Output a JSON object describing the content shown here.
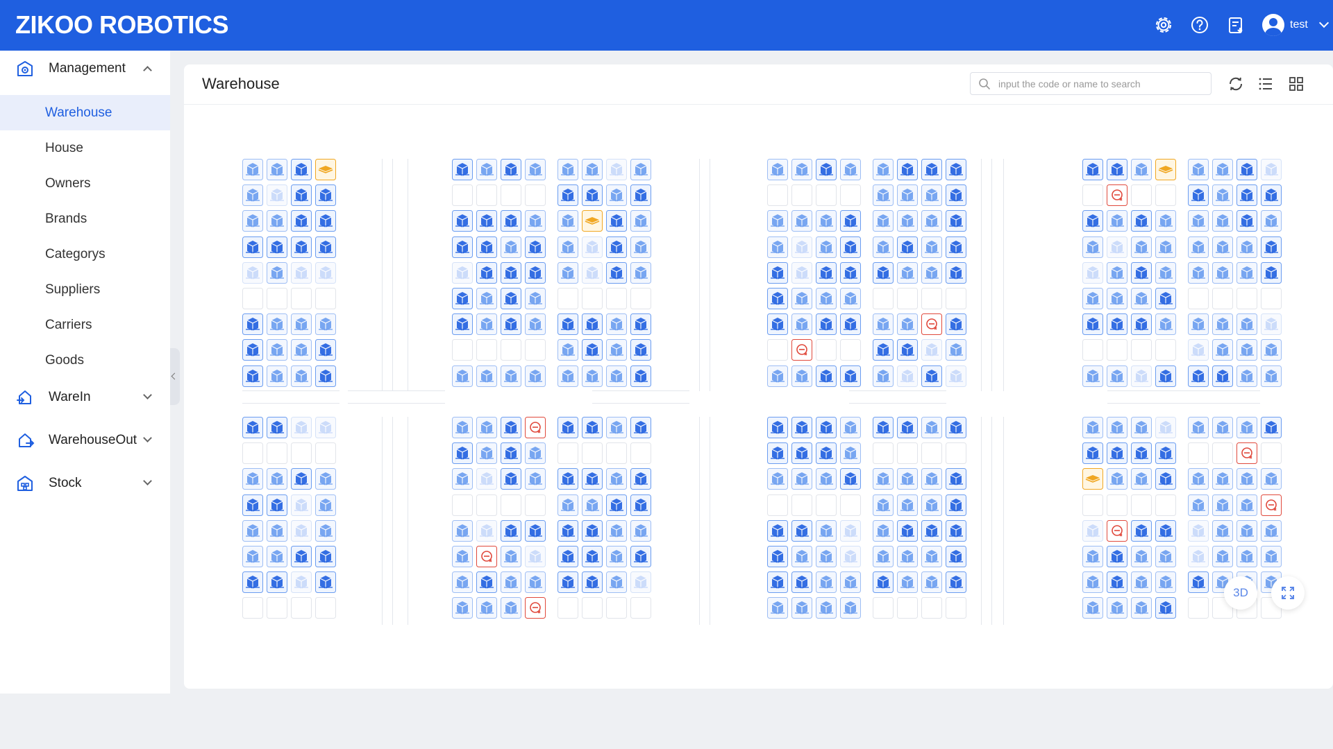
{
  "header": {
    "logo": "ZIKOO ROBOTICS",
    "icons": [
      "gear-icon",
      "help-icon",
      "task-list-icon"
    ],
    "user": {
      "name": "test"
    },
    "colors": {
      "bar": "#1f5fe0"
    }
  },
  "sidebar": {
    "groups": [
      {
        "label": "Management",
        "icon": "warehouse-icon",
        "expanded": true,
        "items": [
          "Warehouse",
          "House",
          "Owners",
          "Brands",
          "Categorys",
          "Suppliers",
          "Carriers",
          "Goods"
        ],
        "active": "Warehouse"
      },
      {
        "label": "WareIn",
        "icon": "inbound-icon",
        "expanded": false
      },
      {
        "label": "WarehouseOut",
        "icon": "outbound-icon",
        "expanded": false
      },
      {
        "label": "Stock",
        "icon": "stock-icon",
        "expanded": false
      }
    ]
  },
  "panel": {
    "title": "Warehouse",
    "search_placeholder": "input the code or name to search",
    "tools": [
      "refresh-icon",
      "list-view-icon",
      "grid-view-icon"
    ],
    "float_3d": "3D"
  },
  "legend_colors": {
    "full": "#1f5fe0",
    "partial": "#6a9cf0",
    "light": "#c6d8fa",
    "empty": "#e1e4ea",
    "pallet": "#f0a722",
    "error": "#e0483b"
  },
  "map": {
    "cell_codes": "F=strong box, P=mid box, L=light box, E=empty, Y=pallet, X=error",
    "blocks": [
      {
        "rows": [
          "PPFY",
          "PLFF",
          "PPFF",
          "FFFF",
          "LPLL",
          "EEEE",
          "FPPP",
          "FPPF",
          "FPPF"
        ]
      },
      {
        "rows": [
          "FPFP",
          "EEEE",
          "FFFP",
          "FFPF",
          "LFFF",
          "FPFP",
          "FPFP",
          "EEEE",
          "PPPP"
        ]
      },
      {
        "rows": [
          "PPLP",
          "FFPF",
          "PYFP",
          "PLFP",
          "PLFP",
          "EEEE",
          "FFPF",
          "PFPF",
          "PPPF"
        ]
      },
      {
        "rows": [
          "PPFP",
          "EEEE",
          "PPPF",
          "PLPF",
          "FLFF",
          "FPPP",
          "FPFF",
          "EXEE",
          "PPFF"
        ]
      },
      {
        "rows": [
          "PFFF",
          "PPPF",
          "PPPF",
          "PFPF",
          "FPPF",
          "EEEE",
          "PPXF",
          "FFLP",
          "PLFL"
        ]
      },
      {
        "rows": [
          "FFPY",
          "EXEE",
          "FPFP",
          "PLPP",
          "LPFP",
          "PPPF",
          "FFFP",
          "EEEE",
          "PPLF"
        ]
      },
      {
        "rows": [
          "PPFL",
          "FPFF",
          "PPFP",
          "PPPF",
          "PPPF",
          "EEEE",
          "PPPL",
          "LPPP",
          "FFPP"
        ]
      },
      {
        "rows": [
          "FFLL",
          "EEEE",
          "PPFP",
          "FFLP",
          "PPLP",
          "PPFF",
          "FFLF",
          "EEEE"
        ]
      },
      {
        "rows": [
          "PPFX",
          "FPFP",
          "PLFP",
          "EEEE",
          "PLFF",
          "PXPL",
          "PFPP",
          "PPPX"
        ]
      },
      {
        "rows": [
          "FFPF",
          "EEEE",
          "FFPF",
          "PPFF",
          "FFPP",
          "FFPF",
          "FFPL",
          "EEEE"
        ]
      },
      {
        "rows": [
          "FFFP",
          "FFFP",
          "PPPF",
          "EEEE",
          "FFPL",
          "FPPL",
          "FFPP",
          "PPPP"
        ]
      },
      {
        "rows": [
          "FFPF",
          "EEEE",
          "PPPF",
          "PPPF",
          "PFFF",
          "PPPF",
          "FPPF",
          "EEEE"
        ]
      },
      {
        "rows": [
          "PPPL",
          "FFFF",
          "YPPF",
          "EEEE",
          "LXFF",
          "PFPP",
          "PFPP",
          "PPPF"
        ]
      },
      {
        "rows": [
          "PPPF",
          "EEXE",
          "PPPP",
          "PPPX",
          "LPPP",
          "LPPP",
          "FPPP",
          "EEEE"
        ]
      }
    ]
  }
}
